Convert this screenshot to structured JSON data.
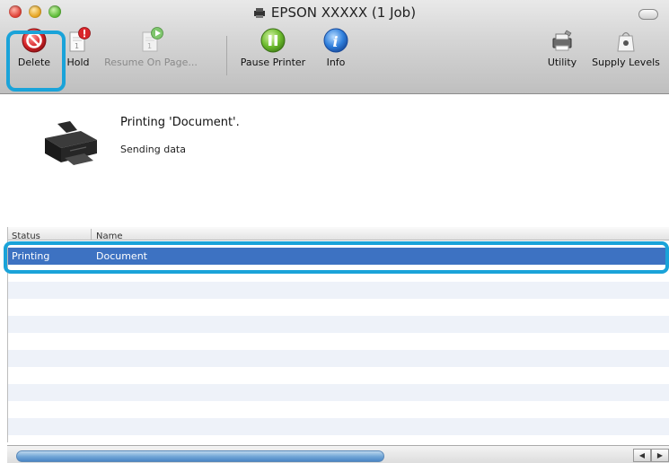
{
  "window": {
    "title": "EPSON XXXXX (1 Job)"
  },
  "toolbar": {
    "delete_label": "Delete",
    "hold_label": "Hold",
    "resume_label": "Resume On Page...",
    "pause_label": "Pause Printer",
    "info_label": "Info",
    "utility_label": "Utility",
    "supply_label": "Supply Levels"
  },
  "printer": {
    "status_title": "Printing 'Document'.",
    "status_detail": "Sending data"
  },
  "table": {
    "columns": [
      "Status",
      "Name"
    ],
    "rows": [
      {
        "status": "Printing",
        "name": "Document",
        "selected": true
      }
    ]
  },
  "colors": {
    "highlight_ring": "#1aa3d9",
    "selection": "#3d72c2"
  },
  "icons": {
    "delete": "no-entry-icon",
    "hold": "document-pause-icon",
    "resume": "document-play-icon",
    "pause": "pause-icon",
    "info": "info-icon",
    "utility": "printer-utility-icon",
    "supply": "ink-bag-icon"
  }
}
